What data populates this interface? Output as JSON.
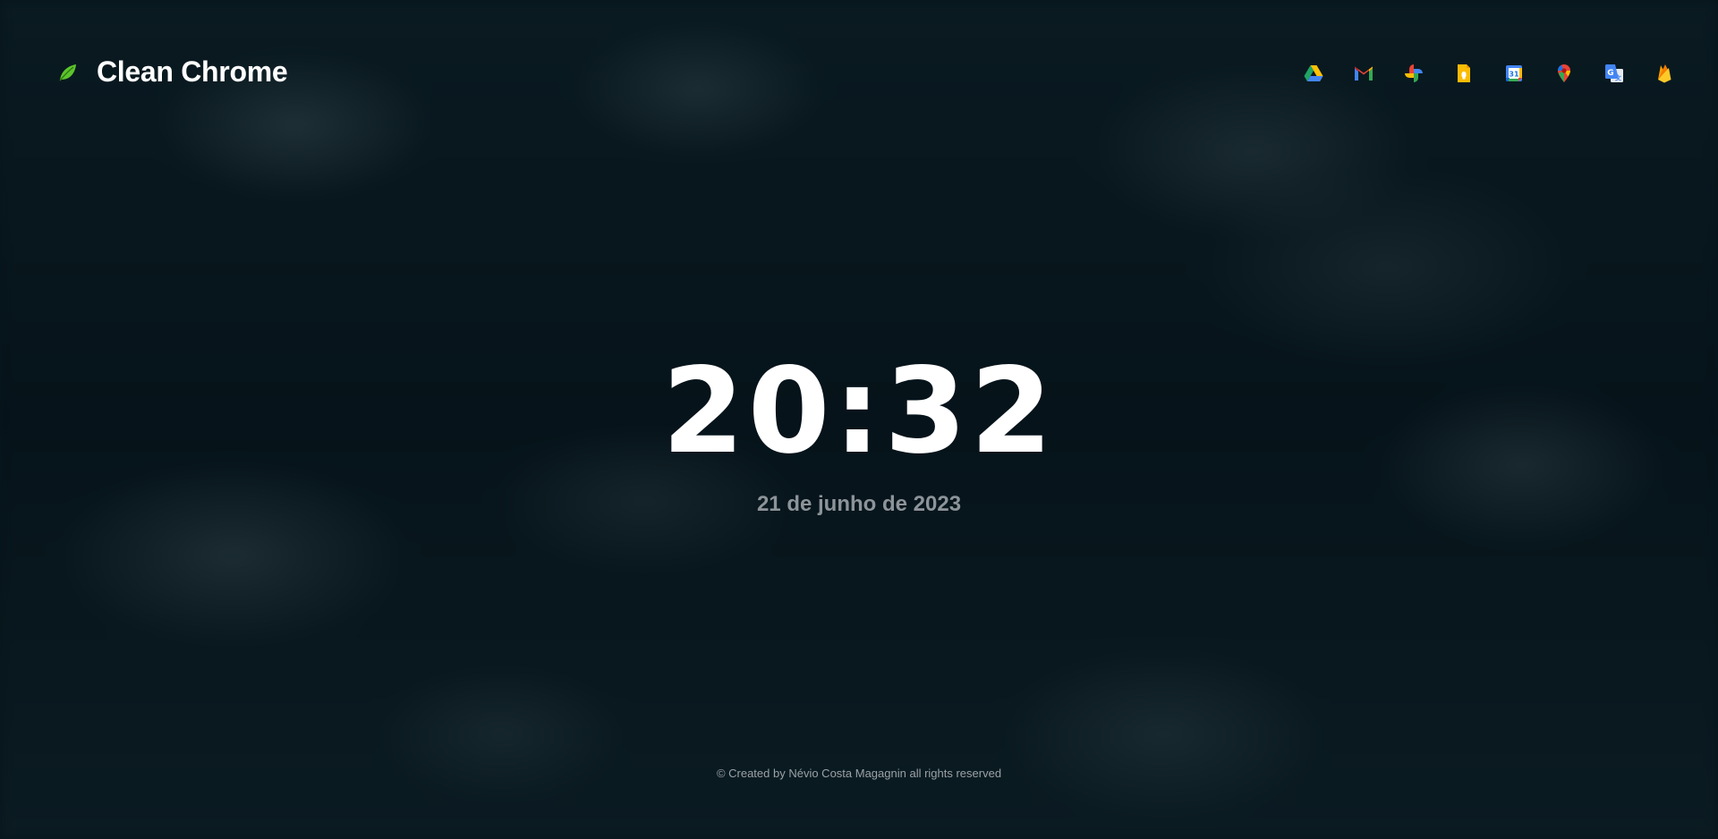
{
  "app": {
    "title": "Clean Chrome",
    "logo_icon": "leaf-icon",
    "logo_color": "#5cc42c"
  },
  "apps": [
    {
      "name": "Google Drive",
      "icon": "google-drive-icon"
    },
    {
      "name": "Gmail",
      "icon": "gmail-icon"
    },
    {
      "name": "Google Photos",
      "icon": "google-photos-icon"
    },
    {
      "name": "Google Keep",
      "icon": "google-keep-icon"
    },
    {
      "name": "Google Calendar",
      "icon": "google-calendar-icon"
    },
    {
      "name": "Google Maps",
      "icon": "google-maps-icon"
    },
    {
      "name": "Google Translate",
      "icon": "google-translate-icon"
    },
    {
      "name": "Firebase",
      "icon": "firebase-icon"
    }
  ],
  "clock": {
    "time": "20:32",
    "date": "21 de junho de 2023"
  },
  "footer": {
    "text": "© Created by Névio Costa Magagnin all rights reserved"
  },
  "colors": {
    "background": "#07141b",
    "date_text": "#8d9499",
    "footer_text": "#9aa2a6"
  }
}
